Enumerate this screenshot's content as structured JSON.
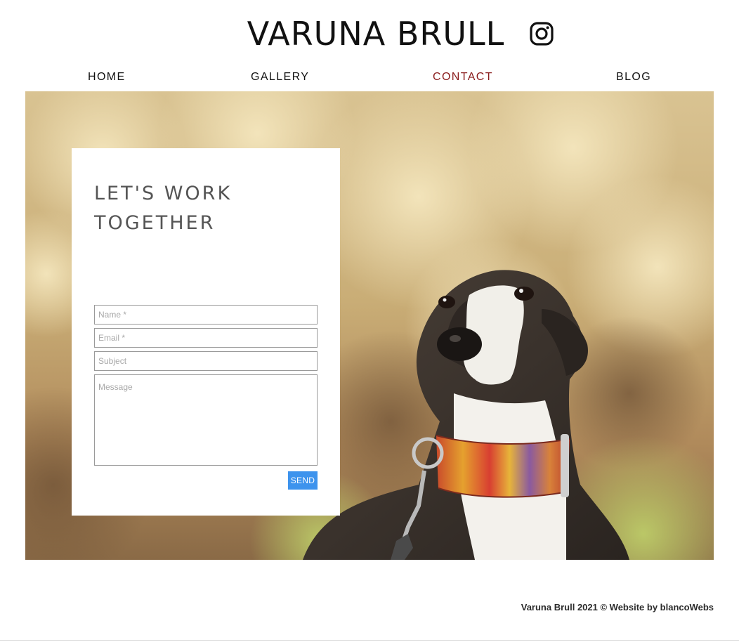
{
  "header": {
    "title": "VARUNA BRULL",
    "instagram_icon": "instagram-icon"
  },
  "nav": {
    "items": [
      {
        "label": "HOME",
        "active": false
      },
      {
        "label": "GALLERY",
        "active": false
      },
      {
        "label": "CONTACT",
        "active": true
      },
      {
        "label": "BLOG",
        "active": false
      }
    ],
    "active_color": "#8a1c1c"
  },
  "hero": {
    "subject": "greyhound-dog-photo"
  },
  "contact_form": {
    "heading_line1": "LET'S WORK",
    "heading_line2": "TOGETHER",
    "name_placeholder": "Name *",
    "email_placeholder": "Email *",
    "subject_placeholder": "Subject",
    "message_placeholder": "Message",
    "send_label": "SEND",
    "send_color": "#3d93ed"
  },
  "footer": {
    "text": "Varuna Brull 2021 © Website by blancoWebs"
  }
}
